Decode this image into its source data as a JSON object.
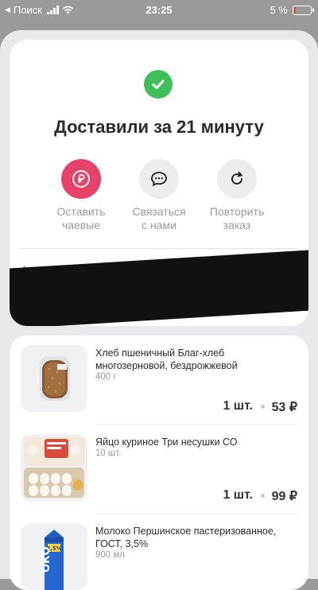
{
  "status_bar": {
    "back": "◀",
    "carrier": "Поиск",
    "time": "23:25",
    "battery": "5 %"
  },
  "order": {
    "title": "Доставили за 21 минуту",
    "actions": [
      {
        "line1": "Оставить",
        "line2": "чаевые",
        "icon": "ruble-icon"
      },
      {
        "line1": "Связаться",
        "line2": "с нами",
        "icon": "chat-icon"
      },
      {
        "line1": "Повторить",
        "line2": "заказ",
        "icon": "repeat-icon"
      }
    ],
    "address_label": "Адр"
  },
  "items": [
    {
      "name": "Хлеб пшеничный Благ-хлеб многозерновой, бездрожжевой",
      "weight": "400 г",
      "qty": "1 шт.",
      "price": "53 ₽",
      "thumb": "bread"
    },
    {
      "name": "Яйцо куриное Три несушки СО",
      "weight": "10 шт.",
      "qty": "1 шт.",
      "price": "99 ₽",
      "thumb": "eggs"
    },
    {
      "name": "Молоко Першинское пастеризованное, ГОСТ, 3,5%",
      "weight": "900 мл",
      "thumb": "milk"
    }
  ],
  "colors": {
    "accent_red": "#e8416a",
    "success_green": "#3fbf5a"
  }
}
